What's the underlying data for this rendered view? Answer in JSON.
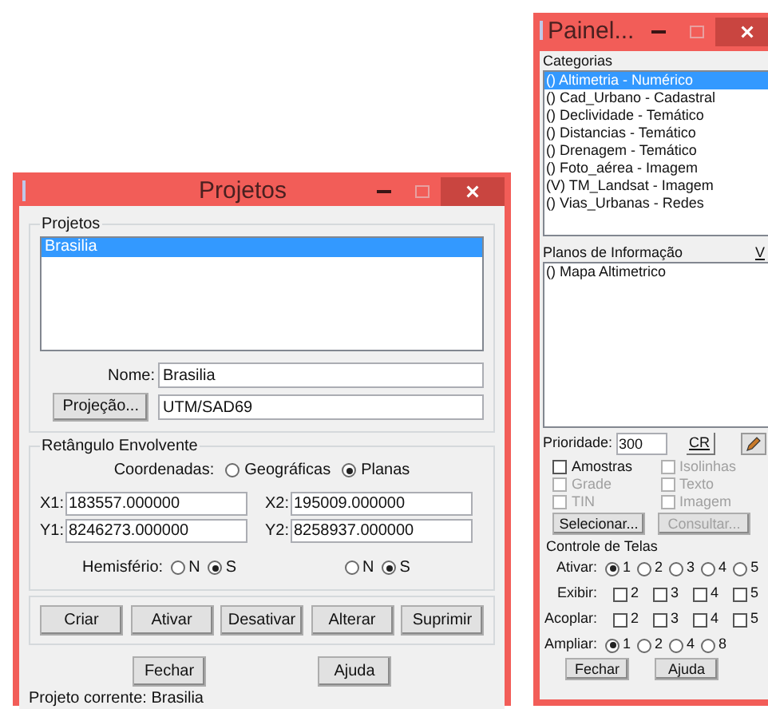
{
  "projetos_window": {
    "title": "Projetos",
    "projetos_group": {
      "label": "Projetos",
      "items": [
        {
          "label": "Brasilia",
          "selected": true
        }
      ]
    },
    "nome": {
      "label": "Nome:",
      "value": "Brasilia"
    },
    "projecao": {
      "button": "Projeção...",
      "value": "UTM/SAD69"
    },
    "retangulo": {
      "label": "Retângulo Envolvente",
      "coordenadas_label": "Coordenadas:",
      "coordenadas_options": [
        {
          "label": "Geográficas",
          "selected": false
        },
        {
          "label": "Planas",
          "selected": true
        }
      ],
      "fields": [
        {
          "label": "X1:",
          "value": "183557.000000"
        },
        {
          "label": "X2:",
          "value": "195009.000000"
        },
        {
          "label": "Y1:",
          "value": "8246273.000000"
        },
        {
          "label": "Y2:",
          "value": "8258937.000000"
        }
      ],
      "hemisferio_label": "Hemisfério:",
      "hemisferio_1": [
        {
          "label": "N",
          "selected": false
        },
        {
          "label": "S",
          "selected": true
        }
      ],
      "hemisferio_2": [
        {
          "label": "N",
          "selected": false
        },
        {
          "label": "S",
          "selected": true
        }
      ]
    },
    "actions": [
      "Criar",
      "Ativar",
      "Desativar",
      "Alterar",
      "Suprimir"
    ],
    "bottom_buttons": [
      "Fechar",
      "Ajuda"
    ],
    "status": "Projeto corrente: Brasilia"
  },
  "painel_window": {
    "title": "Painel...",
    "categorias_label": "Categorias",
    "categorias": [
      {
        "label": "() Altimetria - Numérico",
        "selected": true
      },
      {
        "label": "() Cad_Urbano - Cadastral",
        "selected": false
      },
      {
        "label": "() Declividade - Temático",
        "selected": false
      },
      {
        "label": "() Distancias - Temático",
        "selected": false
      },
      {
        "label": "() Drenagem - Temático",
        "selected": false
      },
      {
        "label": "() Foto_aérea - Imagem",
        "selected": false
      },
      {
        "label": "(V) TM_Landsat - Imagem",
        "selected": false
      },
      {
        "label": "() Vias_Urbanas - Redes",
        "selected": false
      }
    ],
    "planos_label": "Planos de Informação",
    "planos_column_2": "V",
    "planos": [
      {
        "label": "() Mapa Altimetrico",
        "selected": false
      }
    ],
    "prioridade_label": "Prioridade:",
    "prioridade_value": "300",
    "cr_button": "CR",
    "filters": [
      {
        "label": "Amostras",
        "checked": false,
        "disabled": false
      },
      {
        "label": "Isolinhas",
        "checked": false,
        "disabled": true
      },
      {
        "label": "Grade",
        "checked": false,
        "disabled": true
      },
      {
        "label": "Texto",
        "checked": false,
        "disabled": true
      },
      {
        "label": "TIN",
        "checked": false,
        "disabled": true
      },
      {
        "label": "Imagem",
        "checked": false,
        "disabled": true
      }
    ],
    "action_buttons": [
      {
        "label": "Selecionar...",
        "disabled": false
      },
      {
        "label": "Consultar...",
        "disabled": true
      }
    ],
    "controle_label": "Controle de Telas",
    "controle_rows": [
      {
        "label": "Ativar:",
        "kind": "radio",
        "options": [
          {
            "label": "1",
            "selected": true
          },
          {
            "label": "2",
            "selected": false
          },
          {
            "label": "3",
            "selected": false
          },
          {
            "label": "4",
            "selected": false
          },
          {
            "label": "5",
            "selected": false
          }
        ]
      },
      {
        "label": "Exibir:",
        "kind": "checkbox",
        "options": [
          {
            "label": "2",
            "checked": false
          },
          {
            "label": "3",
            "checked": false
          },
          {
            "label": "4",
            "checked": false
          },
          {
            "label": "5",
            "checked": false
          }
        ]
      },
      {
        "label": "Acoplar:",
        "kind": "checkbox",
        "options": [
          {
            "label": "2",
            "checked": false
          },
          {
            "label": "3",
            "checked": false
          },
          {
            "label": "4",
            "checked": false
          },
          {
            "label": "5",
            "checked": false
          }
        ]
      },
      {
        "label": "Ampliar:",
        "kind": "radio",
        "options": [
          {
            "label": "1",
            "selected": true
          },
          {
            "label": "2",
            "selected": false
          },
          {
            "label": "4",
            "selected": false
          },
          {
            "label": "8",
            "selected": false
          }
        ]
      }
    ],
    "bottom_buttons": [
      "Fechar",
      "Ajuda"
    ]
  }
}
